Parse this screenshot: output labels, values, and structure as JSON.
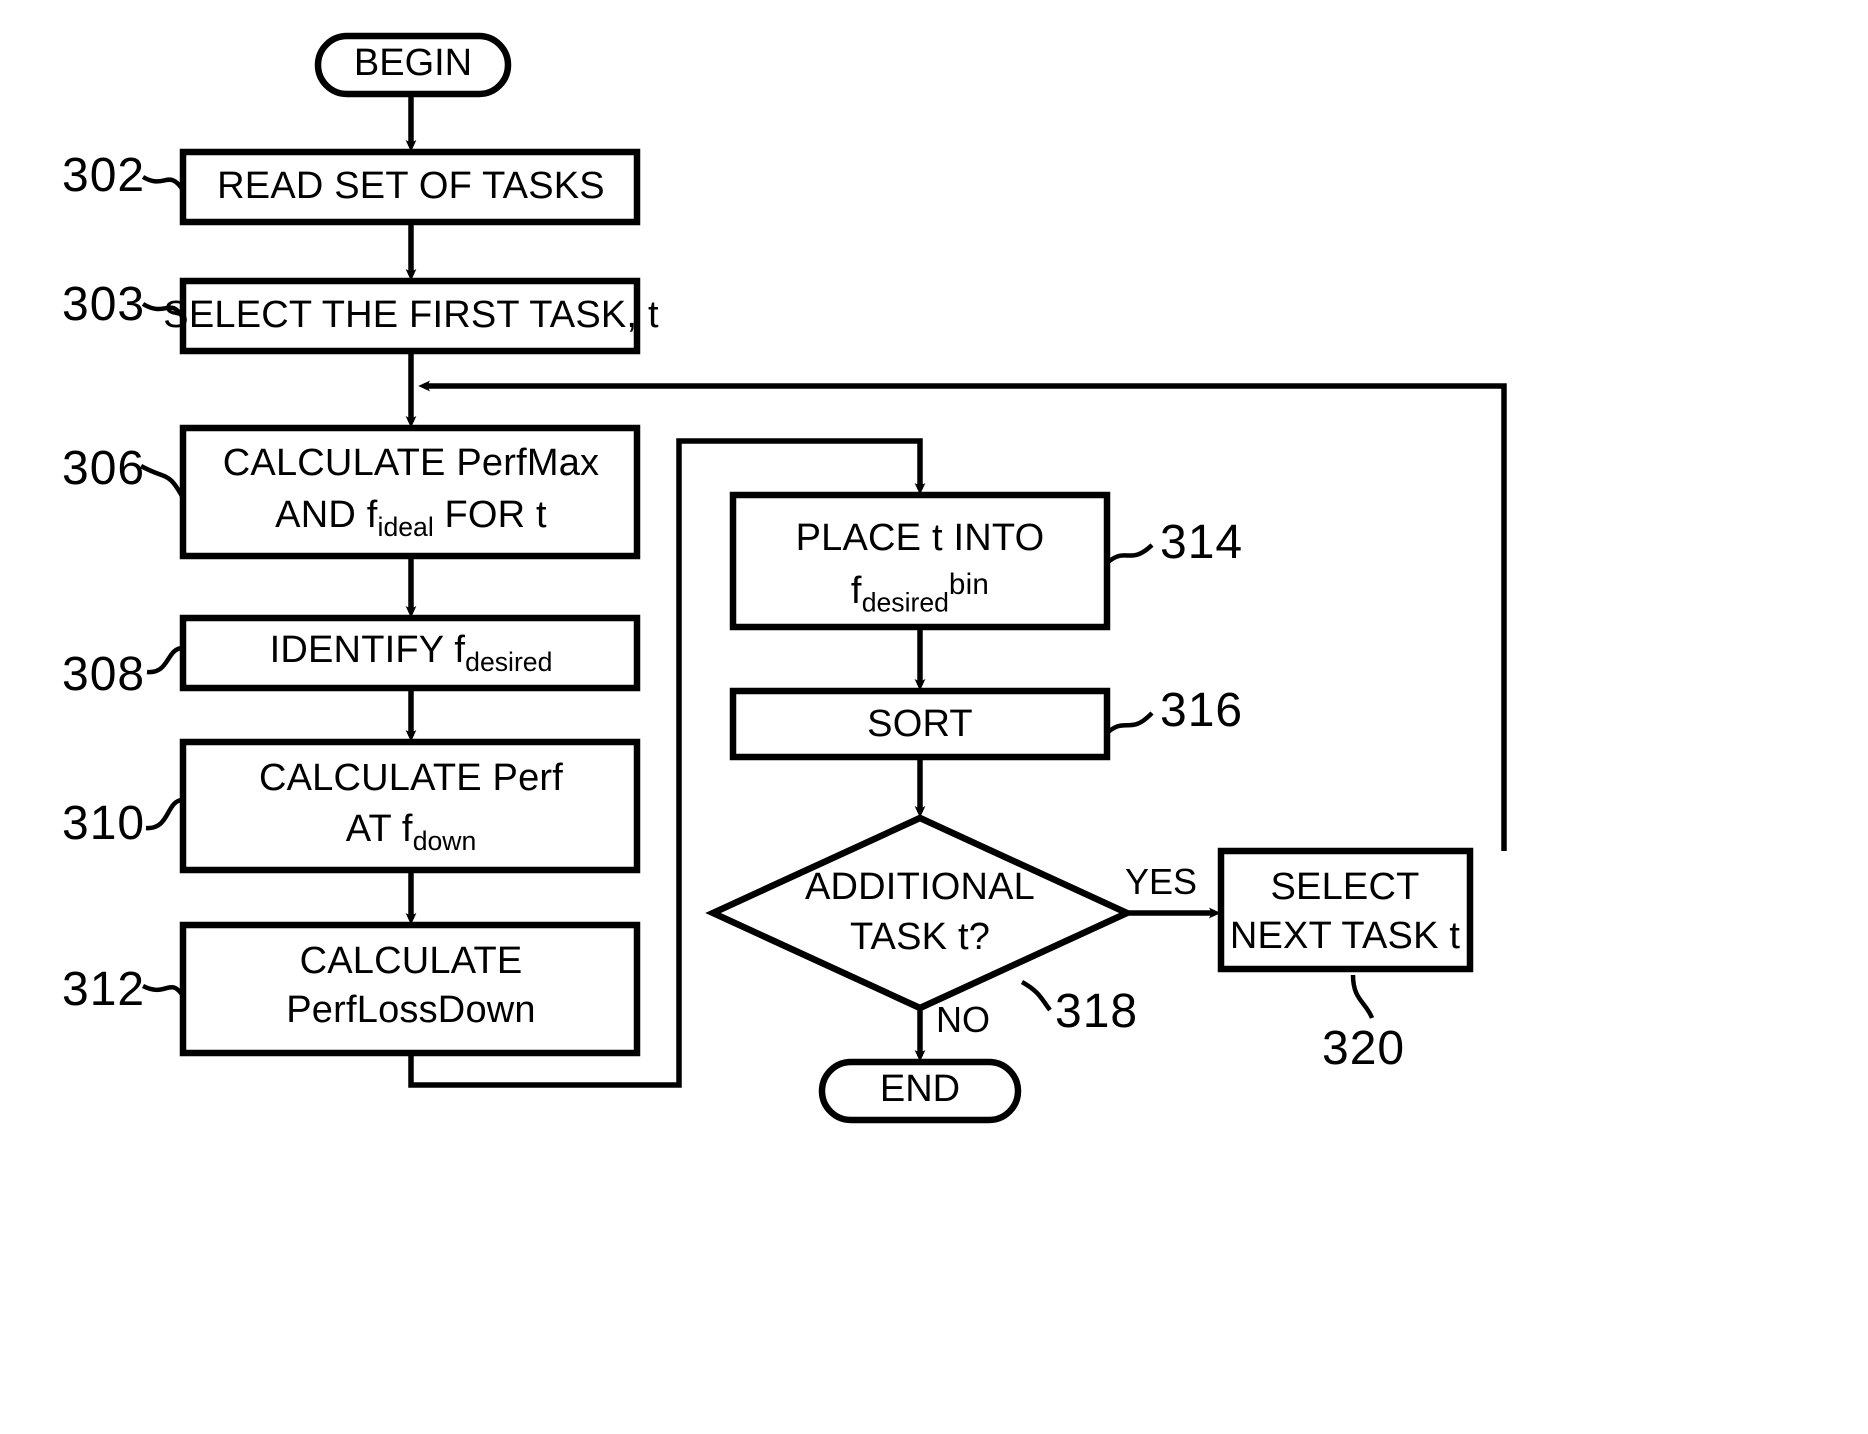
{
  "diagram": {
    "figure_type": "flowchart",
    "terminals": {
      "begin": "BEGIN",
      "end": "END"
    },
    "nodes": [
      {
        "ref": "302",
        "shape": "process",
        "lines": [
          "READ SET OF TASKS"
        ]
      },
      {
        "ref": "303",
        "shape": "process",
        "lines": [
          "SELECT THE FIRST TASK, t"
        ]
      },
      {
        "ref": "306",
        "shape": "process",
        "lines": [
          "CALCULATE PerfMax",
          "AND f_ideal FOR t"
        ],
        "line1": "CALCULATE PerfMax",
        "line2_pre": "AND f",
        "line2_sub": "ideal",
        "line2_post": " FOR t"
      },
      {
        "ref": "308",
        "shape": "process",
        "lines": [
          "IDENTIFY f_desired"
        ],
        "line1_pre": "IDENTIFY f",
        "line1_sub": "desired",
        "line1_post": ""
      },
      {
        "ref": "310",
        "shape": "process",
        "lines": [
          "CALCULATE Perf",
          "AT f_down"
        ],
        "line1": "CALCULATE Perf",
        "line2_pre": "AT f",
        "line2_sub": "down",
        "line2_post": ""
      },
      {
        "ref": "312",
        "shape": "process",
        "lines": [
          "CALCULATE",
          "PerfLossDown"
        ],
        "line1": "CALCULATE",
        "line2": "PerfLossDown"
      },
      {
        "ref": "314",
        "shape": "process",
        "lines": [
          "PLACE t INTO",
          "f_desired bin"
        ],
        "line1": "PLACE t INTO",
        "line2_pre": "f",
        "line2_sub": "desired",
        "line2_sup": "bin"
      },
      {
        "ref": "316",
        "shape": "process",
        "lines": [
          "SORT"
        ]
      },
      {
        "ref": "318",
        "shape": "decision",
        "lines": [
          "ADDITIONAL",
          "TASK t?"
        ],
        "line1": "ADDITIONAL",
        "line2": "TASK t?"
      },
      {
        "ref": "320",
        "shape": "process",
        "lines": [
          "SELECT",
          "NEXT TASK t"
        ],
        "line1": "SELECT",
        "line2": "NEXT TASK t"
      }
    ],
    "branch_labels": {
      "yes": "YES",
      "no": "NO"
    },
    "refs": {
      "n302": "302",
      "n303": "303",
      "n306": "306",
      "n308": "308",
      "n310": "310",
      "n312": "312",
      "n314": "314",
      "n316": "316",
      "n318": "318",
      "n320": "320"
    },
    "colors": {
      "stroke": "#000000",
      "background": "#ffffff"
    }
  }
}
